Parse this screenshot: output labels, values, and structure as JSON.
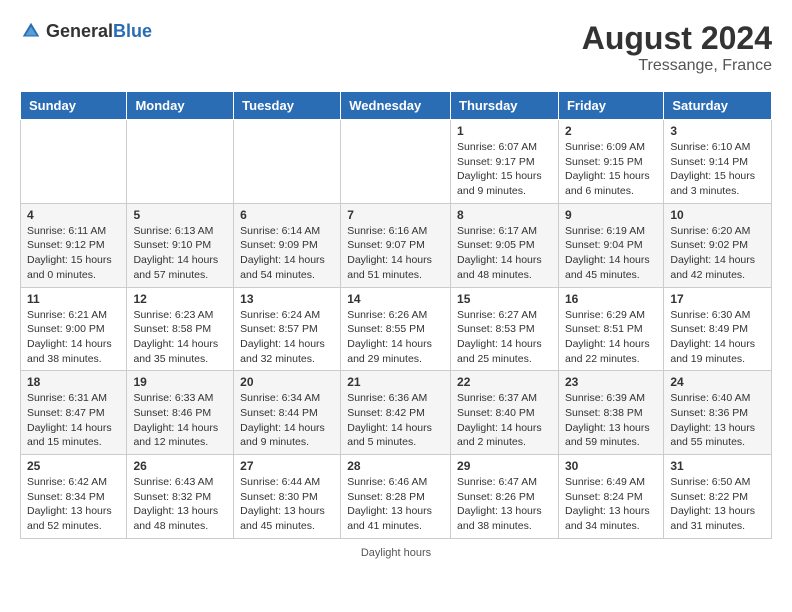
{
  "header": {
    "logo_general": "General",
    "logo_blue": "Blue",
    "month_year": "August 2024",
    "location": "Tressange, France"
  },
  "days_of_week": [
    "Sunday",
    "Monday",
    "Tuesday",
    "Wednesday",
    "Thursday",
    "Friday",
    "Saturday"
  ],
  "weeks": [
    [
      {
        "day": "",
        "sunrise": "",
        "sunset": "",
        "daylight": ""
      },
      {
        "day": "",
        "sunrise": "",
        "sunset": "",
        "daylight": ""
      },
      {
        "day": "",
        "sunrise": "",
        "sunset": "",
        "daylight": ""
      },
      {
        "day": "",
        "sunrise": "",
        "sunset": "",
        "daylight": ""
      },
      {
        "day": "1",
        "sunrise": "Sunrise: 6:07 AM",
        "sunset": "Sunset: 9:17 PM",
        "daylight": "Daylight: 15 hours and 9 minutes."
      },
      {
        "day": "2",
        "sunrise": "Sunrise: 6:09 AM",
        "sunset": "Sunset: 9:15 PM",
        "daylight": "Daylight: 15 hours and 6 minutes."
      },
      {
        "day": "3",
        "sunrise": "Sunrise: 6:10 AM",
        "sunset": "Sunset: 9:14 PM",
        "daylight": "Daylight: 15 hours and 3 minutes."
      }
    ],
    [
      {
        "day": "4",
        "sunrise": "Sunrise: 6:11 AM",
        "sunset": "Sunset: 9:12 PM",
        "daylight": "Daylight: 15 hours and 0 minutes."
      },
      {
        "day": "5",
        "sunrise": "Sunrise: 6:13 AM",
        "sunset": "Sunset: 9:10 PM",
        "daylight": "Daylight: 14 hours and 57 minutes."
      },
      {
        "day": "6",
        "sunrise": "Sunrise: 6:14 AM",
        "sunset": "Sunset: 9:09 PM",
        "daylight": "Daylight: 14 hours and 54 minutes."
      },
      {
        "day": "7",
        "sunrise": "Sunrise: 6:16 AM",
        "sunset": "Sunset: 9:07 PM",
        "daylight": "Daylight: 14 hours and 51 minutes."
      },
      {
        "day": "8",
        "sunrise": "Sunrise: 6:17 AM",
        "sunset": "Sunset: 9:05 PM",
        "daylight": "Daylight: 14 hours and 48 minutes."
      },
      {
        "day": "9",
        "sunrise": "Sunrise: 6:19 AM",
        "sunset": "Sunset: 9:04 PM",
        "daylight": "Daylight: 14 hours and 45 minutes."
      },
      {
        "day": "10",
        "sunrise": "Sunrise: 6:20 AM",
        "sunset": "Sunset: 9:02 PM",
        "daylight": "Daylight: 14 hours and 42 minutes."
      }
    ],
    [
      {
        "day": "11",
        "sunrise": "Sunrise: 6:21 AM",
        "sunset": "Sunset: 9:00 PM",
        "daylight": "Daylight: 14 hours and 38 minutes."
      },
      {
        "day": "12",
        "sunrise": "Sunrise: 6:23 AM",
        "sunset": "Sunset: 8:58 PM",
        "daylight": "Daylight: 14 hours and 35 minutes."
      },
      {
        "day": "13",
        "sunrise": "Sunrise: 6:24 AM",
        "sunset": "Sunset: 8:57 PM",
        "daylight": "Daylight: 14 hours and 32 minutes."
      },
      {
        "day": "14",
        "sunrise": "Sunrise: 6:26 AM",
        "sunset": "Sunset: 8:55 PM",
        "daylight": "Daylight: 14 hours and 29 minutes."
      },
      {
        "day": "15",
        "sunrise": "Sunrise: 6:27 AM",
        "sunset": "Sunset: 8:53 PM",
        "daylight": "Daylight: 14 hours and 25 minutes."
      },
      {
        "day": "16",
        "sunrise": "Sunrise: 6:29 AM",
        "sunset": "Sunset: 8:51 PM",
        "daylight": "Daylight: 14 hours and 22 minutes."
      },
      {
        "day": "17",
        "sunrise": "Sunrise: 6:30 AM",
        "sunset": "Sunset: 8:49 PM",
        "daylight": "Daylight: 14 hours and 19 minutes."
      }
    ],
    [
      {
        "day": "18",
        "sunrise": "Sunrise: 6:31 AM",
        "sunset": "Sunset: 8:47 PM",
        "daylight": "Daylight: 14 hours and 15 minutes."
      },
      {
        "day": "19",
        "sunrise": "Sunrise: 6:33 AM",
        "sunset": "Sunset: 8:46 PM",
        "daylight": "Daylight: 14 hours and 12 minutes."
      },
      {
        "day": "20",
        "sunrise": "Sunrise: 6:34 AM",
        "sunset": "Sunset: 8:44 PM",
        "daylight": "Daylight: 14 hours and 9 minutes."
      },
      {
        "day": "21",
        "sunrise": "Sunrise: 6:36 AM",
        "sunset": "Sunset: 8:42 PM",
        "daylight": "Daylight: 14 hours and 5 minutes."
      },
      {
        "day": "22",
        "sunrise": "Sunrise: 6:37 AM",
        "sunset": "Sunset: 8:40 PM",
        "daylight": "Daylight: 14 hours and 2 minutes."
      },
      {
        "day": "23",
        "sunrise": "Sunrise: 6:39 AM",
        "sunset": "Sunset: 8:38 PM",
        "daylight": "Daylight: 13 hours and 59 minutes."
      },
      {
        "day": "24",
        "sunrise": "Sunrise: 6:40 AM",
        "sunset": "Sunset: 8:36 PM",
        "daylight": "Daylight: 13 hours and 55 minutes."
      }
    ],
    [
      {
        "day": "25",
        "sunrise": "Sunrise: 6:42 AM",
        "sunset": "Sunset: 8:34 PM",
        "daylight": "Daylight: 13 hours and 52 minutes."
      },
      {
        "day": "26",
        "sunrise": "Sunrise: 6:43 AM",
        "sunset": "Sunset: 8:32 PM",
        "daylight": "Daylight: 13 hours and 48 minutes."
      },
      {
        "day": "27",
        "sunrise": "Sunrise: 6:44 AM",
        "sunset": "Sunset: 8:30 PM",
        "daylight": "Daylight: 13 hours and 45 minutes."
      },
      {
        "day": "28",
        "sunrise": "Sunrise: 6:46 AM",
        "sunset": "Sunset: 8:28 PM",
        "daylight": "Daylight: 13 hours and 41 minutes."
      },
      {
        "day": "29",
        "sunrise": "Sunrise: 6:47 AM",
        "sunset": "Sunset: 8:26 PM",
        "daylight": "Daylight: 13 hours and 38 minutes."
      },
      {
        "day": "30",
        "sunrise": "Sunrise: 6:49 AM",
        "sunset": "Sunset: 8:24 PM",
        "daylight": "Daylight: 13 hours and 34 minutes."
      },
      {
        "day": "31",
        "sunrise": "Sunrise: 6:50 AM",
        "sunset": "Sunset: 8:22 PM",
        "daylight": "Daylight: 13 hours and 31 minutes."
      }
    ]
  ],
  "footer": "Daylight hours"
}
